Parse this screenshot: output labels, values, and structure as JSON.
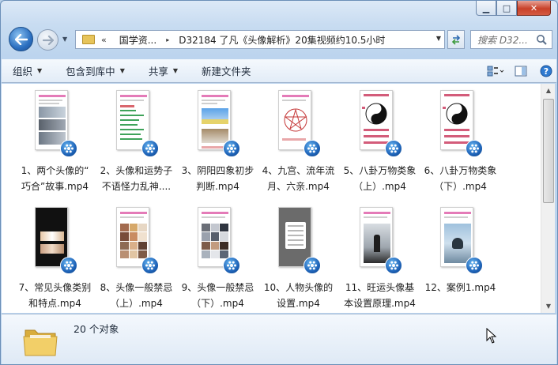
{
  "window": {
    "caption": {
      "minimize": "▁",
      "maximize": "□",
      "close": "✕"
    }
  },
  "address": {
    "chevron": "«",
    "crumbs": [
      "国学资...",
      "D32184 了凡《头像解析》20集视频约10.5小时"
    ],
    "separator": "▸"
  },
  "search": {
    "placeholder": "搜索 D32..."
  },
  "toolbar": {
    "organize": "组织",
    "include_in_library": "包含到库中",
    "share": "共享",
    "new_folder": "新建文件夹"
  },
  "files": [
    {
      "line1": "1、两个头像的“",
      "line2": "巧合”故事.mp4",
      "style": "photos"
    },
    {
      "line1": "2、头像和运势子",
      "line2": "不语怪力乱神....",
      "style": "text"
    },
    {
      "line1": "3、阴阳四象初步",
      "line2": "判断.mp4",
      "style": "landscape"
    },
    {
      "line1": "4、九宫、流年流",
      "line2": "月、六亲.mp4",
      "style": "star"
    },
    {
      "line1": "5、八卦万物类象",
      "line2": "（上）.mp4",
      "style": "yinyang"
    },
    {
      "line1": "6、八卦万物类象",
      "line2": "（下）.mp4",
      "style": "yinyang"
    },
    {
      "line1": "7、常见头像类别",
      "line2": "和特点.mp4",
      "style": "dark"
    },
    {
      "line1": "8、头像一般禁忌",
      "line2": "（上）.mp4",
      "style": "grid"
    },
    {
      "line1": "9、头像一般禁忌",
      "line2": "（下）.mp4",
      "style": "grid2"
    },
    {
      "line1": "10、人物头像的",
      "line2": "设置.mp4",
      "style": "dialog"
    },
    {
      "line1": "11、旺运头像基",
      "line2": "本设置原理.mp4",
      "style": "person"
    },
    {
      "line1": "12、案例1.mp4",
      "line2": "",
      "style": "meditate"
    }
  ],
  "status": {
    "count": "20 个对象"
  },
  "icons": {
    "back": "back-arrow-icon",
    "forward": "forward-arrow-icon",
    "play": "media-player-icon"
  },
  "colors": {
    "accent": "#2b6fc0",
    "folder": "#e7c45a"
  }
}
